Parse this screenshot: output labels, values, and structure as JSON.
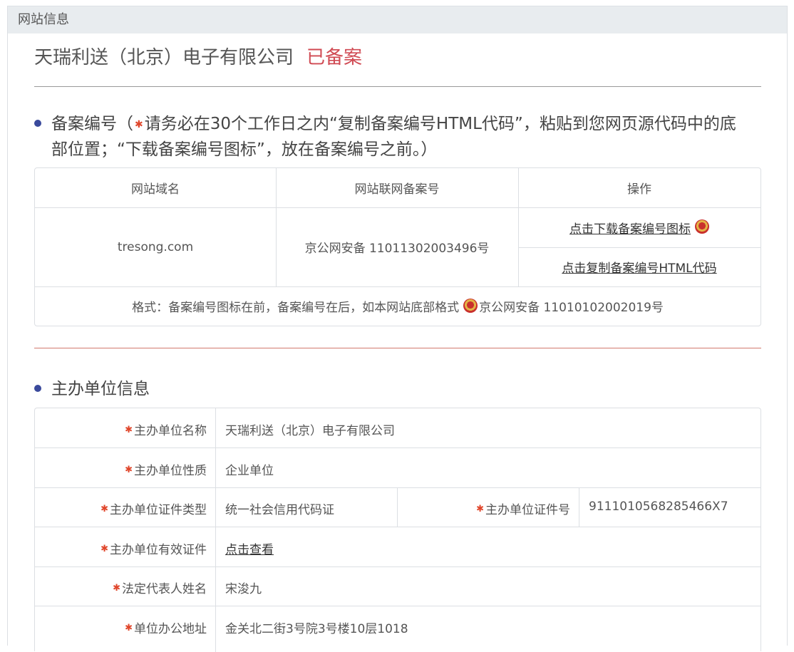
{
  "panel": {
    "title": "网站信息"
  },
  "site": {
    "company_name": "天瑞利送（北京）电子有限公司",
    "status": "已备案"
  },
  "record_section": {
    "heading_prefix": "备案编号（",
    "heading_line1_rest": "请务必在30个工作日之内“复制备案编号HTML代码”，粘贴到您网页源代码中的底",
    "heading_line2": "部位置；“下载备案编号图标”，放在备案编号之前。）",
    "columns": [
      "网站域名",
      "网站联网备案号",
      "操作"
    ],
    "domain": "tresong.com",
    "record_number": "京公网安备 11011302003496号",
    "download_icon_link": "点击下载备案编号图标",
    "copy_html_link": "点击复制备案编号HTML代码",
    "format_prefix": "格式：备案编号图标在前，备案编号在后，如本网站底部格式",
    "format_example": "京公网安备 11010102002019号"
  },
  "org_section": {
    "heading": "主办单位信息",
    "rows": [
      {
        "label": "主办单位名称",
        "value": "天瑞利送（北京）电子有限公司"
      },
      {
        "label": "主办单位性质",
        "value": "企业单位"
      },
      {
        "label": "主办单位证件类型",
        "value": "统一社会信用代码证",
        "label2": "主办单位证件号",
        "value2": "9111010568285466X7"
      },
      {
        "label": "主办单位有效证件",
        "value": "点击查看"
      },
      {
        "label": "法定代表人姓名",
        "value": "宋浚九"
      },
      {
        "label": "单位办公地址",
        "value": "金关北二街3号院3号楼10层1018"
      }
    ]
  },
  "colors": {
    "status": "#d04a53",
    "required_star": "#e0462b",
    "bullet": "#3a4a9c",
    "header_bg": "#e8ecef"
  }
}
